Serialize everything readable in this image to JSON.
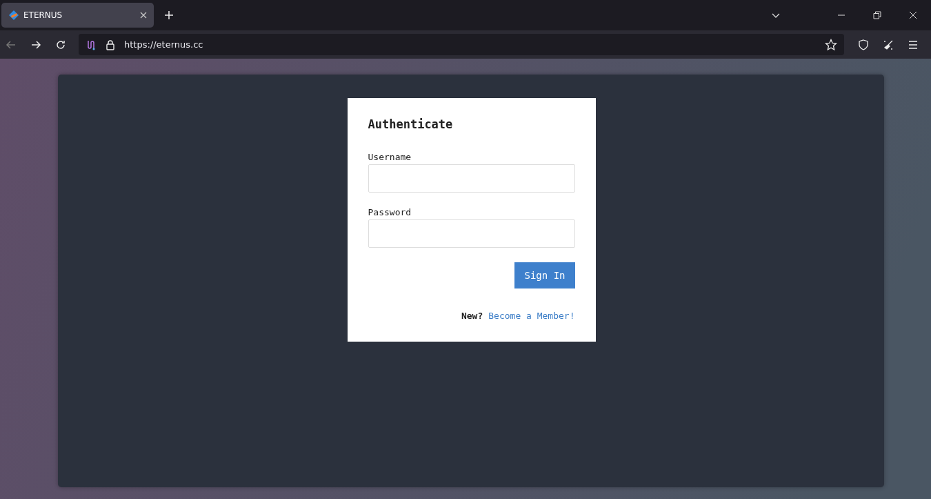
{
  "browser": {
    "tabs": [
      {
        "title": "ETERNUS",
        "selected": true
      }
    ],
    "address": "https://eternus.cc"
  },
  "login": {
    "title": "Authenticate",
    "fields": [
      {
        "label": "Username"
      },
      {
        "label": "Password"
      }
    ],
    "submit": "Sign In",
    "signup_prompt": "New?",
    "signup_link": "Become a Member!"
  }
}
